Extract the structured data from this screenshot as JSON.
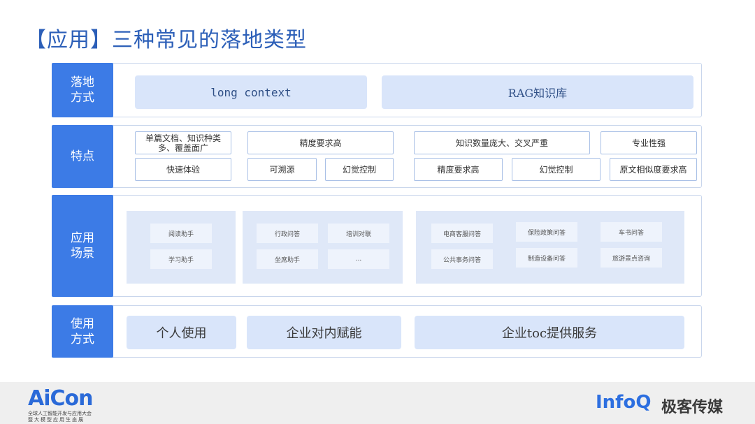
{
  "title": "【应用】三种常见的落地类型",
  "rows": {
    "deploy": {
      "label": "落地方式",
      "items": [
        "long context",
        "RAG知识库"
      ]
    },
    "features": {
      "label": "特点",
      "lc": [
        "单篇文档、知识种类多、覆盖面广",
        "快速体验",
        "精度要求高",
        "可溯源",
        "幻觉控制"
      ],
      "rag": [
        "知识数量庞大、交叉严重",
        "专业性强",
        "精度要求高",
        "幻觉控制",
        "原文相似度要求高"
      ]
    },
    "scenes": {
      "label": "应用场景",
      "g1": [
        "阅读助手",
        "学习助手"
      ],
      "g2": [
        "行政问答",
        "培训对联",
        "坐席助手",
        "..."
      ],
      "g3": [
        "电商客服问答",
        "保险政策问答",
        "车书问答",
        "公共事务问答",
        "制造设备问答",
        "旅游景点咨询"
      ]
    },
    "usage": {
      "label": "使用方式",
      "items": [
        "个人使用",
        "企业对内赋能",
        "企业toc提供服务"
      ]
    }
  },
  "footer": {
    "aicon": "AiCon",
    "aicon_line1": "全球人工智能开发与应用大会",
    "aicon_line2": "暨大模型应用生态展",
    "infoq": "InfoQ",
    "media": "极客传媒"
  }
}
